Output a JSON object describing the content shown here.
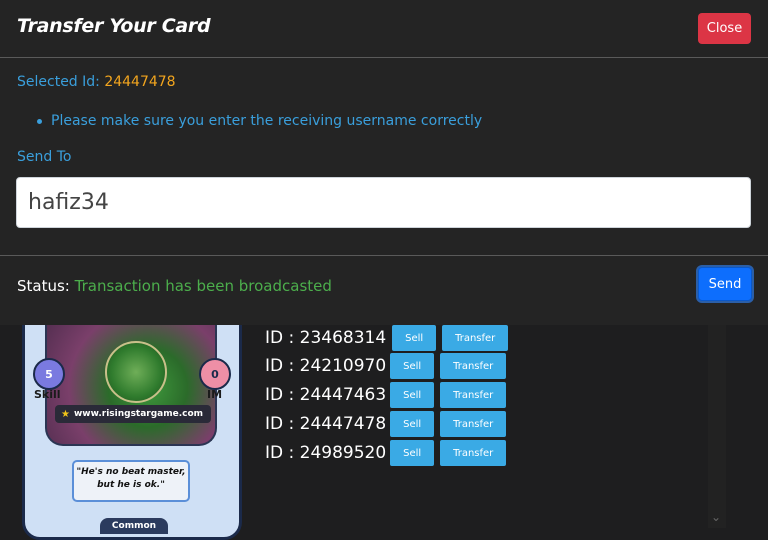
{
  "modal": {
    "title": "Transfer Your Card",
    "close_label": "Close",
    "selected_label": "Selected Id:",
    "selected_id": "24447478",
    "note": "Please make sure you enter the receiving username correctly",
    "send_to_label": "Send To",
    "send_to_value": "hafiz34",
    "status_label": "Status:",
    "status_value": "Transaction has been broadcasted",
    "send_label": "Send"
  },
  "card": {
    "site": "www.risingstargame.com",
    "skill_value": "5",
    "skill_label": "Skill",
    "im_value": "0",
    "im_label": "IM",
    "quote": "\"He's no beat master, but he is ok.\"",
    "rarity": "Common"
  },
  "ids": [
    {
      "label": "ID : 23468314",
      "sell": "Sell",
      "transfer": "Transfer"
    },
    {
      "label": "ID : 24210970",
      "sell": "Sell",
      "transfer": "Transfer"
    },
    {
      "label": "ID : 24447463",
      "sell": "Sell",
      "transfer": "Transfer"
    },
    {
      "label": "ID : 24447478",
      "sell": "Sell",
      "transfer": "Transfer"
    },
    {
      "label": "ID : 24989520",
      "sell": "Sell",
      "transfer": "Transfer"
    }
  ],
  "colors": {
    "accent": "#3a9fdc",
    "selected_id": "#f2a51e",
    "status_success": "#4cae4c",
    "close_button": "#dc3545",
    "send_button": "#0d6efd",
    "action_button": "#3aaae5"
  },
  "icons": {
    "note_bullet": "bullet-icon",
    "site_star": "star-icon",
    "scroll_down": "chevron-down-icon"
  }
}
